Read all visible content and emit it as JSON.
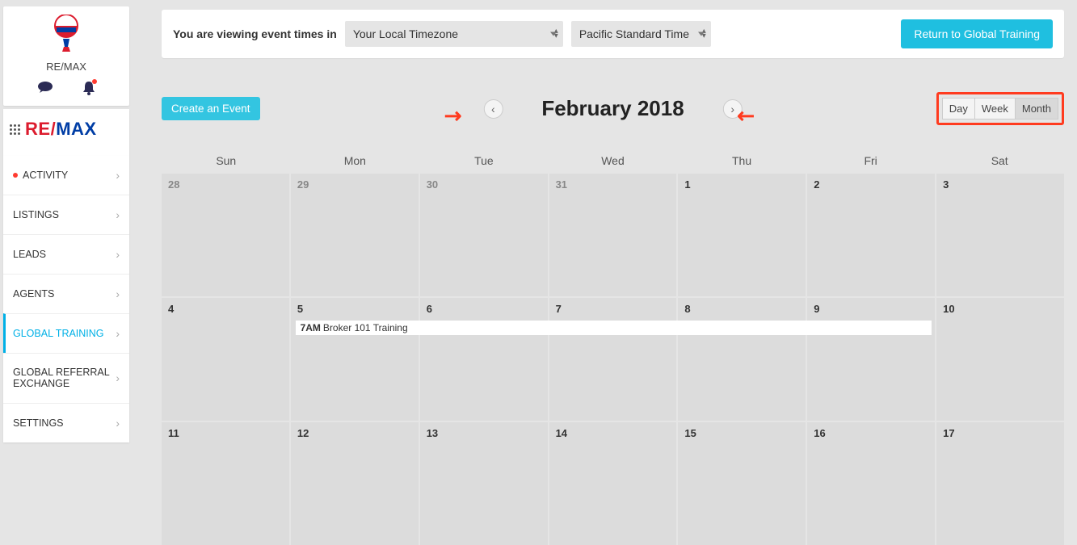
{
  "sidebar": {
    "brand": "RE/MAX",
    "logo_re": "RE",
    "logo_slash": "/",
    "logo_max": "MAX",
    "items": [
      {
        "label": "ACTIVITY",
        "dot": true
      },
      {
        "label": "LISTINGS"
      },
      {
        "label": "LEADS"
      },
      {
        "label": "AGENTS"
      },
      {
        "label": "GLOBAL TRAINING",
        "active": true
      },
      {
        "label": "GLOBAL REFERRAL EXCHANGE"
      },
      {
        "label": "SETTINGS"
      }
    ]
  },
  "banner": {
    "lead": "You are viewing event times in",
    "tz_mode": "Your Local Timezone",
    "tz_value": "Pacific Standard Time",
    "return_btn": "Return to Global Training"
  },
  "toolbar": {
    "create": "Create an Event",
    "prev": "‹",
    "next": "›",
    "title": "February 2018",
    "views": {
      "day": "Day",
      "week": "Week",
      "month": "Month",
      "active": "month"
    }
  },
  "calendar": {
    "dow": [
      "Sun",
      "Mon",
      "Tue",
      "Wed",
      "Thu",
      "Fri",
      "Sat"
    ],
    "cells": [
      {
        "n": "28",
        "cur": false
      },
      {
        "n": "29",
        "cur": false
      },
      {
        "n": "30",
        "cur": false
      },
      {
        "n": "31",
        "cur": false
      },
      {
        "n": "1",
        "cur": true
      },
      {
        "n": "2",
        "cur": true
      },
      {
        "n": "3",
        "cur": true
      },
      {
        "n": "4",
        "cur": true
      },
      {
        "n": "5",
        "cur": true
      },
      {
        "n": "6",
        "cur": true
      },
      {
        "n": "7",
        "cur": true
      },
      {
        "n": "8",
        "cur": true
      },
      {
        "n": "9",
        "cur": true
      },
      {
        "n": "10",
        "cur": true
      },
      {
        "n": "11",
        "cur": true
      },
      {
        "n": "12",
        "cur": true
      },
      {
        "n": "13",
        "cur": true
      },
      {
        "n": "14",
        "cur": true
      },
      {
        "n": "15",
        "cur": true
      },
      {
        "n": "16",
        "cur": true
      },
      {
        "n": "17",
        "cur": true
      }
    ],
    "event": {
      "time": "7AM",
      "title": "Broker 101 Training"
    }
  }
}
